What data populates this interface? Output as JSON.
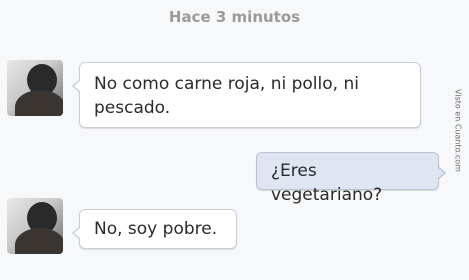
{
  "timestamp": "Hace 3 minutos",
  "messages": [
    {
      "side": "received",
      "text": "No como carne roja, ni pollo, ni pescado."
    },
    {
      "side": "sent",
      "text": "¿Eres vegetariano?"
    },
    {
      "side": "received",
      "text": "No, soy pobre."
    }
  ],
  "watermark": "Visto en Cuanto.com",
  "colors": {
    "background": "#f7f8fa",
    "received_bubble": "#ffffff",
    "sent_bubble": "#dfe6f1",
    "timestamp": "#9a9a9a"
  }
}
